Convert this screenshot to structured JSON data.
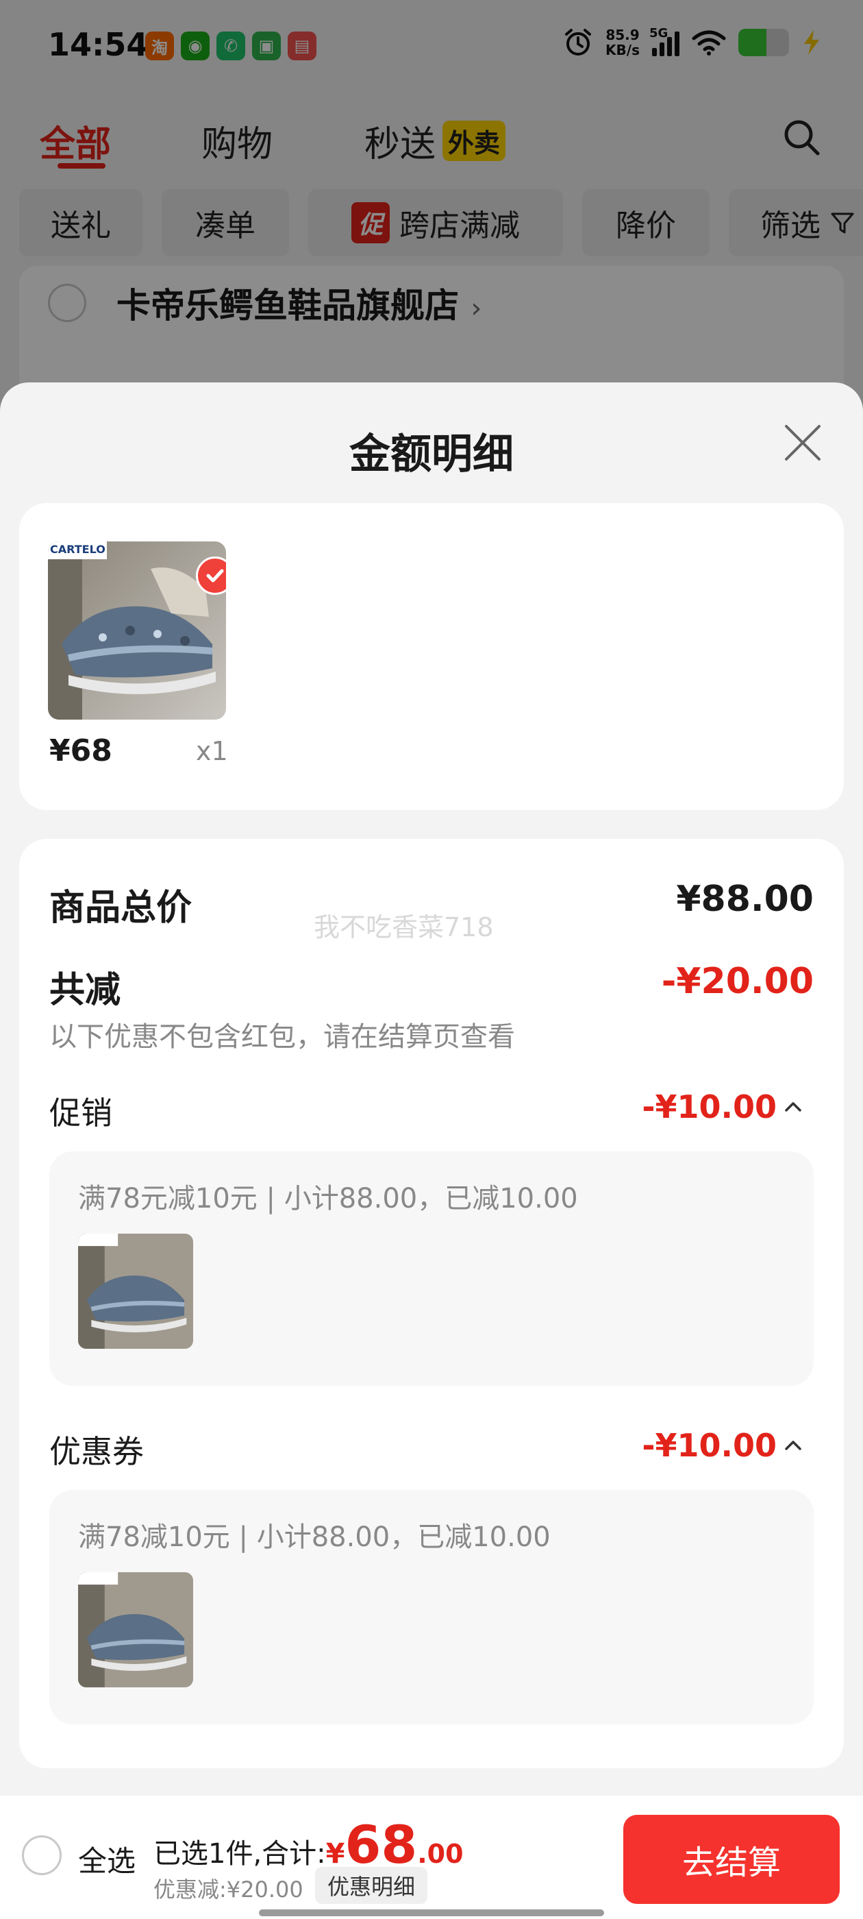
{
  "status_bar": {
    "time": "14:54",
    "app_icons": [
      {
        "name": "taobao-icon",
        "glyph": "淘",
        "color": "#ff6a00"
      },
      {
        "name": "wechat-icon",
        "glyph": "◉",
        "color": "#1aad19"
      },
      {
        "name": "phone-app-icon",
        "glyph": "✆",
        "color": "#1fc16b"
      },
      {
        "name": "game-app-icon",
        "glyph": "▣",
        "color": "#2fb24c"
      },
      {
        "name": "note-app-icon",
        "glyph": "▤",
        "color": "#f0524f"
      }
    ],
    "net_speed_value": "85.9",
    "net_speed_unit": "KB/s",
    "network": "5G",
    "battery_level": 0.55
  },
  "top_tabs": {
    "all": "全部",
    "shopping": "购物",
    "express": "秒送",
    "takeout_badge": "外卖"
  },
  "filters": {
    "gift": "送礼",
    "bundle": "凑单",
    "promo_tag": "促",
    "cross_store": "跨店满减",
    "price_drop": "降价",
    "filter": "筛选"
  },
  "store": {
    "name": "卡帝乐鳄鱼鞋品旗舰店",
    "chevron": "›"
  },
  "sheet": {
    "title": "金额明细",
    "item": {
      "brand_logo": "CARTELO",
      "price": "¥68",
      "qty": "x1"
    },
    "goods_total_label": "商品总价",
    "goods_total_value": "¥88.00",
    "watermark": "我不吃香菜718",
    "total_reduction_label": "共减",
    "total_reduction_value": "-¥20.00",
    "note": "以下优惠不包含红包，请在结算页查看",
    "promotion": {
      "label": "促销",
      "value": "-¥10.00",
      "desc": "满78元减10元 | 小计88.00，已减10.00"
    },
    "coupon": {
      "label": "优惠券",
      "value": "-¥10.00",
      "desc": "满78减10元 | 小计88.00，已减10.00"
    }
  },
  "checkout": {
    "select_all": "全选",
    "selected_text": "已选1件,合计:",
    "yen": "¥",
    "total_int": "68",
    "total_dec": ".00",
    "discount_text": "优惠减:¥20.00",
    "detail_button": "优惠明细",
    "checkout_button": "去结算"
  },
  "colors": {
    "accent_red": "#e2231a",
    "checkout_red": "#f5322d",
    "takeout_yellow": "#ffd400"
  }
}
